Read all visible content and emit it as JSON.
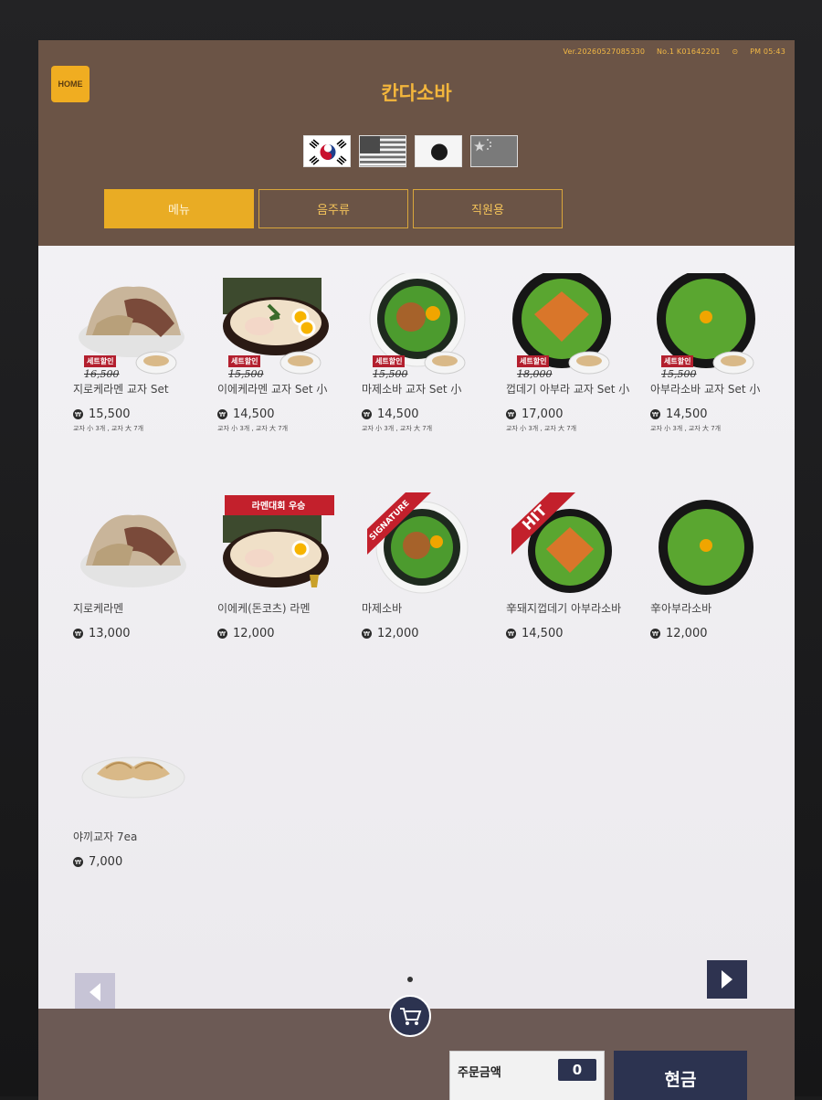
{
  "status_bar": {
    "version": "Ver.20260527085330",
    "kiosk_no": "No.1 K01642201",
    "time": "PM 05:43"
  },
  "header": {
    "home_label": "HOME",
    "title": "칸다소바",
    "flags": [
      "korea-flag-icon",
      "usa-flag-icon",
      "japan-flag-icon",
      "china-flag-icon"
    ]
  },
  "tabs": [
    {
      "label": "메뉴",
      "active": true
    },
    {
      "label": "음주류",
      "active": false
    },
    {
      "label": "직원용",
      "active": false
    }
  ],
  "menu": [
    {
      "name": "지로케라멘 교자 Set",
      "price": "15,500",
      "sub": "교자 小 3개 , 교자 大 7개",
      "badge": "세트할인",
      "original": "16,500"
    },
    {
      "name": "이에케라멘 교자 Set 小",
      "price": "14,500",
      "sub": "교자 小 3개 , 교자 大 7개",
      "badge": "세트할인",
      "original": "15,500"
    },
    {
      "name": "마제소바 교자 Set 小",
      "price": "14,500",
      "sub": "교자 小 3개 , 교자 大 7개",
      "badge": "세트할인",
      "original": "15,500"
    },
    {
      "name": "껍데기 아부라 교자 Set 小",
      "price": "17,000",
      "sub": "교자 小 3개 , 교자 大 7개",
      "badge": "세트할인",
      "original": "18,000"
    },
    {
      "name": "아부라소바 교자 Set 小",
      "price": "14,500",
      "sub": "교자 小 3개 , 교자 大 7개",
      "badge": "세트할인",
      "original": "15,500"
    },
    {
      "name": "지로케라멘",
      "price": "13,000"
    },
    {
      "name": "이에케(돈코츠) 라멘",
      "price": "12,000",
      "ribbon": "라멘대회 우승"
    },
    {
      "name": "마제소바",
      "price": "12,000",
      "ribbon": "SIGNATURE"
    },
    {
      "name": "辛돼지껍데기 아부라소바",
      "price": "14,500",
      "ribbon": "HIT"
    },
    {
      "name": "辛아부라소바",
      "price": "12,000"
    },
    {
      "name": "야끼교자 7ea",
      "price": "7,000"
    }
  ],
  "currency_symbol": "₩",
  "footer": {
    "total_label": "주문금액",
    "total_count": "0",
    "pay_label": "현금"
  },
  "colors": {
    "header_bg": "#6b5446",
    "accent": "#f0ad21",
    "set_badge": "#b31f2e",
    "navy": "#2c3350"
  }
}
